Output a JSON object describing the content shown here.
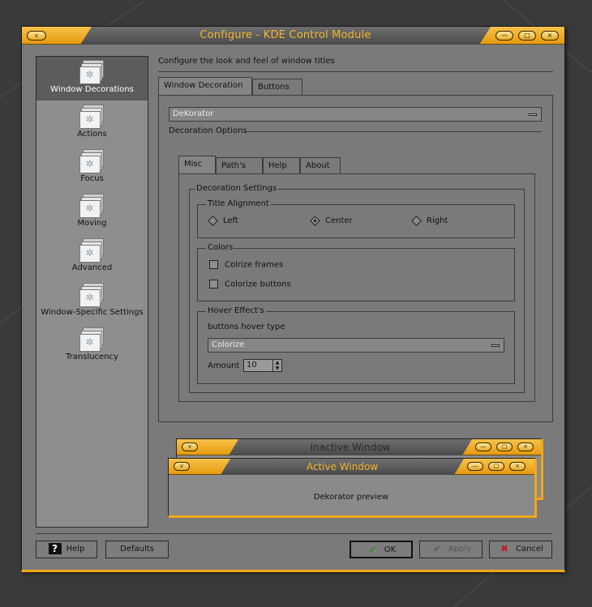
{
  "window": {
    "title": "Configure - KDE Control Module",
    "menu_glyph": "v",
    "buttons": {
      "minimize": "—",
      "maximize": "□",
      "close": "×"
    }
  },
  "sidebar": {
    "items": [
      {
        "label": "Window Decorations",
        "active": true
      },
      {
        "label": "Actions"
      },
      {
        "label": "Focus"
      },
      {
        "label": "Moving"
      },
      {
        "label": "Advanced"
      },
      {
        "label": "Window-Specific Settings"
      },
      {
        "label": "Translucency"
      }
    ]
  },
  "content": {
    "description": "Configure the look and feel of window titles",
    "tabs": [
      "Window Decoration",
      "Buttons"
    ],
    "decoration_select": "DeKorator",
    "decoration_options_title": "Decoration Options",
    "inner_tabs": [
      "Misc",
      "Path's",
      "Help",
      "About"
    ],
    "decoration_settings_title": "Decoration Settings",
    "title_alignment": {
      "title": "Title Alignment",
      "options": [
        "Left",
        "Center",
        "Right"
      ],
      "selected": "Center"
    },
    "colors": {
      "title": "Colors",
      "colorize_frames": "Colrize frames",
      "colorize_buttons": "Colorize buttons"
    },
    "hover": {
      "title": "Hover Effect's",
      "type_label": "buttons hover type",
      "type_value": "Colorize",
      "amount_label": "Amount",
      "amount_value": "10"
    }
  },
  "preview": {
    "inactive_title": "Inactive Window",
    "active_title": "Active Window",
    "body_text": "Dekorator preview"
  },
  "footer": {
    "help": "Help",
    "defaults": "Defaults",
    "ok": "OK",
    "apply": "Apply",
    "cancel": "Cancel"
  },
  "colors": {
    "accent": "#f0a818",
    "frame": "#7a7a7a",
    "titlebar_dark": "#4a4a4a"
  }
}
